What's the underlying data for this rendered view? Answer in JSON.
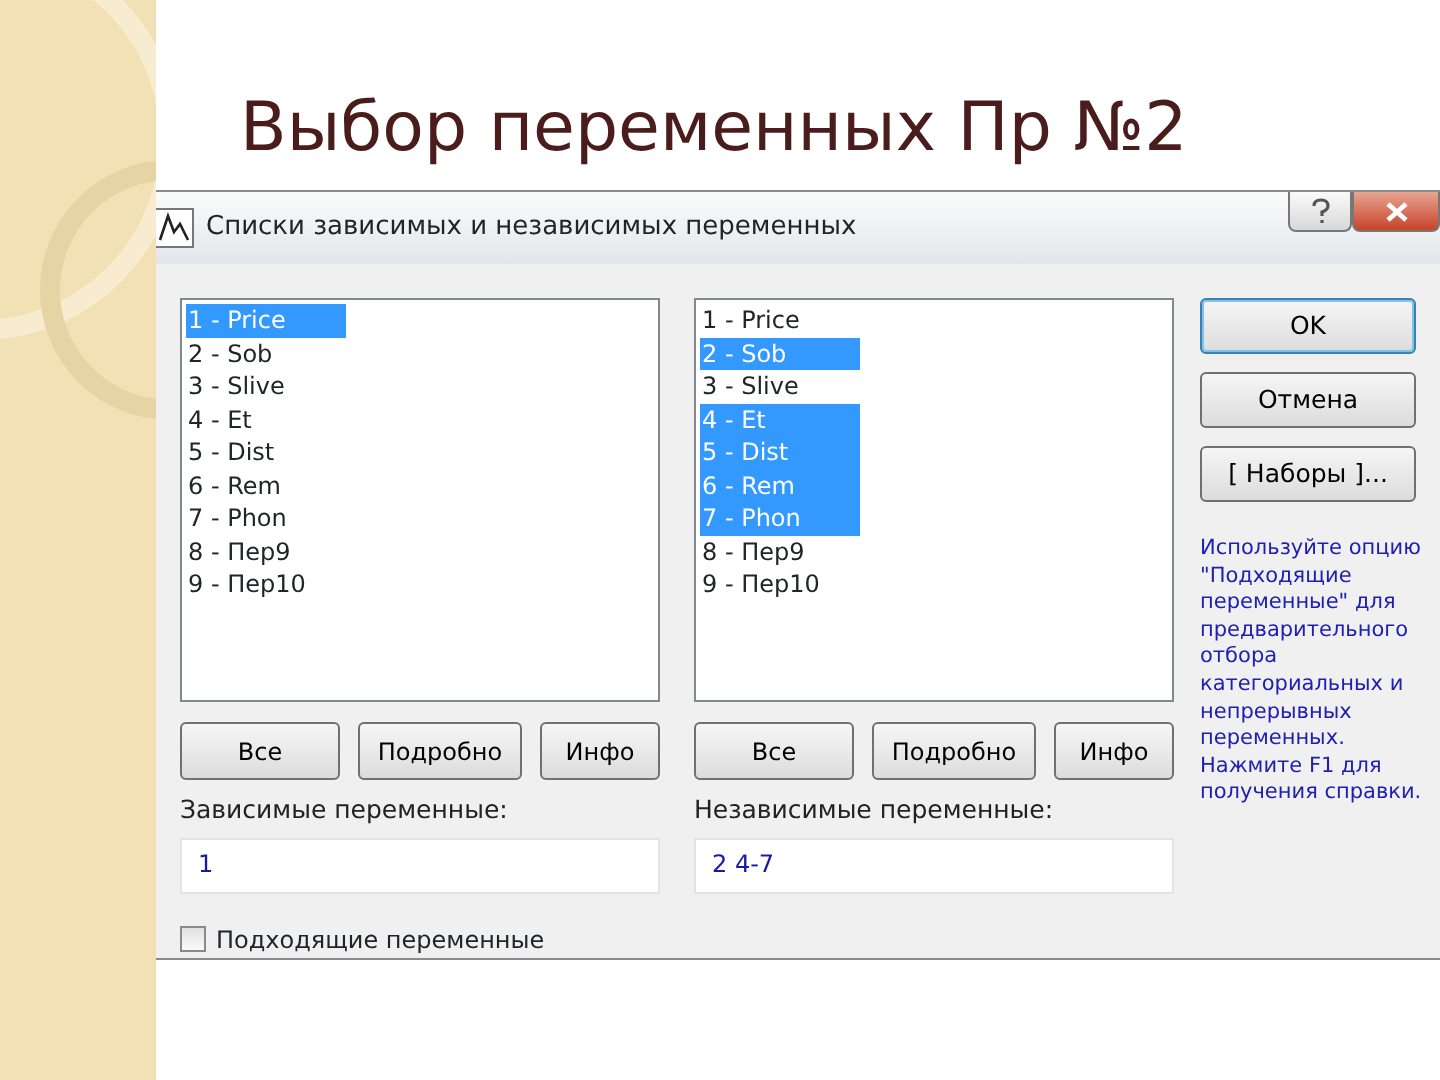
{
  "slide": {
    "title": "Выбор переменных Пр №2"
  },
  "dialog": {
    "title": "Списки зависимых и независимых переменных",
    "panels": [
      {
        "items": [
          {
            "label": "1 - Price",
            "selected": true
          },
          {
            "label": "2 - Sob",
            "selected": false
          },
          {
            "label": "3 - Slive",
            "selected": false
          },
          {
            "label": "4 - Et",
            "selected": false
          },
          {
            "label": "5 - Dist",
            "selected": false
          },
          {
            "label": "6 - Rem",
            "selected": false
          },
          {
            "label": "7 - Phon",
            "selected": false
          },
          {
            "label": "8 - Пер9",
            "selected": false
          },
          {
            "label": "9 - Пер10",
            "selected": false
          }
        ],
        "buttons": [
          "Все",
          "Подробно",
          "Инфо"
        ],
        "field_label": "Зависимые переменные:",
        "field_value": "1"
      },
      {
        "items": [
          {
            "label": "1 - Price",
            "selected": false
          },
          {
            "label": "2 - Sob",
            "selected": true
          },
          {
            "label": "3 - Slive",
            "selected": false
          },
          {
            "label": "4 - Et",
            "selected": true
          },
          {
            "label": "5 - Dist",
            "selected": true
          },
          {
            "label": "6 - Rem",
            "selected": true
          },
          {
            "label": "7 - Phon",
            "selected": true
          },
          {
            "label": "8 - Пер9",
            "selected": false
          },
          {
            "label": "9 - Пер10",
            "selected": false
          }
        ],
        "buttons": [
          "Все",
          "Подробно",
          "Инфо"
        ],
        "field_label": "Независимые переменные:",
        "field_value": "2 4-7"
      }
    ],
    "side_buttons": [
      {
        "label": "OK",
        "default": true
      },
      {
        "label": "Отмена",
        "default": false
      },
      {
        "label": "[ Наборы ]...",
        "default": false
      }
    ],
    "help_text": "Используйте опцию \"Подходящие переменные\" для предварительного отбора категориальных и непрерывных переменных. Нажмите F1 для получения справки.",
    "checkbox": {
      "label": "Подходящие переменные",
      "checked": false
    }
  }
}
